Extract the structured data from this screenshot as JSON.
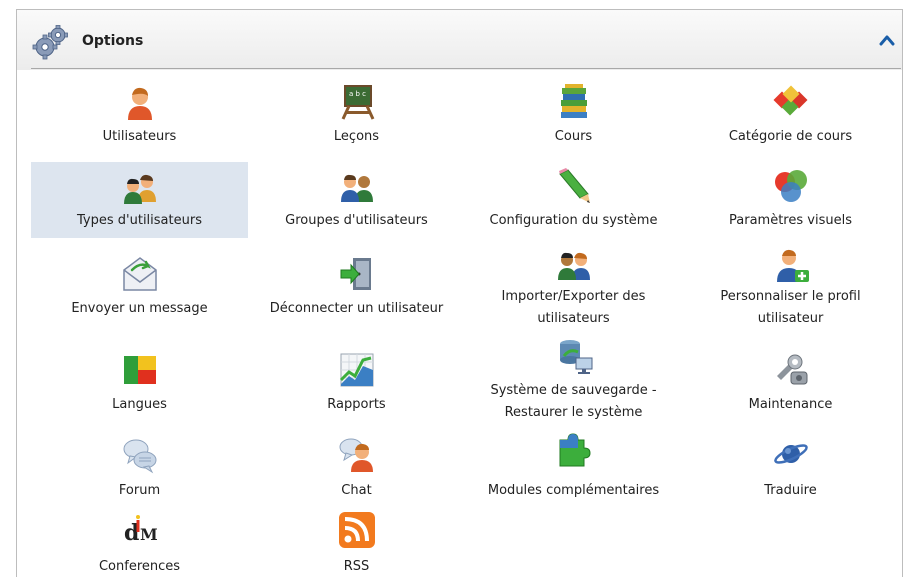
{
  "header": {
    "title": "Options",
    "settings_icon": "gears-icon",
    "collapse_icon": "chevron-up-icon",
    "accent_color": "#1a5ea8"
  },
  "items": [
    {
      "label": "Utilisateurs",
      "icon": "user-icon"
    },
    {
      "label": "Leçons",
      "icon": "chalkboard-icon"
    },
    {
      "label": "Cours",
      "icon": "books-icon"
    },
    {
      "label": "Catégorie de cours",
      "icon": "cubes-icon"
    },
    {
      "label": "Types d'utilisateurs",
      "icon": "user-types-icon",
      "selected": true
    },
    {
      "label": "Groupes d'utilisateurs",
      "icon": "user-group-icon"
    },
    {
      "label": "Configuration du système",
      "icon": "pencil-icon"
    },
    {
      "label": "Paramètres visuels",
      "icon": "color-circles-icon"
    },
    {
      "label": "Envoyer un message",
      "icon": "envelope-icon"
    },
    {
      "label": "Déconnecter un utilisateur",
      "icon": "logout-door-icon"
    },
    {
      "label": "Importer/Exporter des utilisateurs",
      "icon": "users-exchange-icon"
    },
    {
      "label": "Personnaliser le profil utilisateur",
      "icon": "user-add-icon"
    },
    {
      "label": "Langues",
      "icon": "flag-icon"
    },
    {
      "label": "Rapports",
      "icon": "chart-icon"
    },
    {
      "label": "Système de sauvegarde - Restaurer le système",
      "icon": "backup-icon"
    },
    {
      "label": "Maintenance",
      "icon": "tools-icon"
    },
    {
      "label": "Forum",
      "icon": "speech-bubbles-icon"
    },
    {
      "label": "Chat",
      "icon": "chat-user-icon"
    },
    {
      "label": "Modules complémentaires",
      "icon": "puzzle-icon"
    },
    {
      "label": "Traduire",
      "icon": "planet-icon"
    },
    {
      "label": "Conferences",
      "icon": "dim-logo-icon"
    },
    {
      "label": "RSS",
      "icon": "rss-icon"
    }
  ]
}
